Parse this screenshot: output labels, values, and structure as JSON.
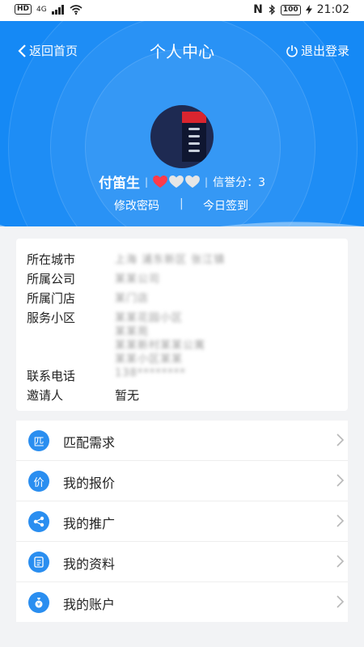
{
  "status_bar": {
    "left_badge": "HD",
    "network": "4G",
    "nfc": "N",
    "battery": "100",
    "time": "21:02"
  },
  "header": {
    "back_label": "返回首页",
    "title": "个人中心",
    "logout_label": "退出登录",
    "user_name": "付笛生",
    "hearts_filled": 1,
    "hearts_total": 3,
    "credit_text": "信誉分：3",
    "change_password": "修改密码",
    "sign_in_today": "今日签到",
    "link_separator": "|"
  },
  "info": {
    "city_label": "所在城市",
    "city_value": "上海 浦东新区 张江镇",
    "company_label": "所属公司",
    "company_value": "某某公司",
    "store_label": "所属门店",
    "store_value": "某门店",
    "community_label": "服务小区",
    "community_value_1": "某某花园小区",
    "community_value_2": "某某苑",
    "community_value_3": "某某新村某某公寓",
    "community_value_4": "某某小区某某",
    "phone_label": "联系电话",
    "phone_value": "138********",
    "inviter_label": "邀请人",
    "inviter_value": "暂无"
  },
  "menu": [
    {
      "icon_char": "匹",
      "label": "匹配需求"
    },
    {
      "icon_char": "价",
      "label": "我的报价"
    },
    {
      "icon_char": "share",
      "label": "我的推广"
    },
    {
      "icon_char": "profile",
      "label": "我的资料"
    },
    {
      "icon_char": "money",
      "label": "我的账户"
    }
  ],
  "colors": {
    "primary": "#1589f5",
    "icon_bg": "#2a8ef0",
    "heart_on": "#ff3b4a",
    "heart_off": "#e6e6e6"
  }
}
